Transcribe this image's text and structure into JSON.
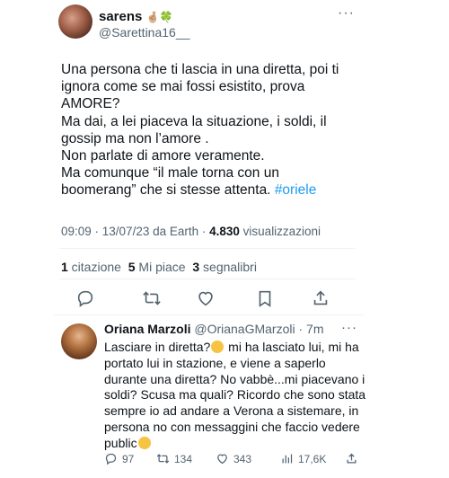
{
  "tweet": {
    "display_name": "sarens",
    "name_emojis": "🤞🏼🍀",
    "handle": "@Sarettina16__",
    "more_label": "···",
    "text_lines": [
      "Una persona che ti lascia in una diretta, poi ti",
      "ignora come se mai fossi esistito, prova",
      "AMORE?",
      "Ma dai, a lei piaceva la situazione, i soldi, il",
      "gossip ma non l’amore .",
      "Non parlate di amore veramente.",
      "Ma comunque “il male torna con un",
      "boomerang” che si stesse attenta. "
    ],
    "hashtag": "#oriele",
    "meta_time": "09:09 · 13/07/23 da Earth · ",
    "meta_views_count": "4.830",
    "meta_views_label": " visualizzazioni",
    "stats": {
      "quotes_count": "1",
      "quotes_label": " citazione",
      "likes_count": "5",
      "likes_label": " Mi piace",
      "bookmarks_count": "3",
      "bookmarks_label": " segnalibri"
    },
    "actions": [
      "reply-icon",
      "retweet-icon",
      "like-icon",
      "bookmark-icon",
      "share-icon"
    ]
  },
  "reply": {
    "display_name": "Oriana Marzoli",
    "handle_time": " @OrianaGMarzoli · 7m",
    "more_label": "···",
    "text_lines": [
      [
        "Lasciare in diretta?",
        "emoji",
        " mi ha lasciato lui, mi ha"
      ],
      [
        "portato lui in stazione, e viene a saperlo"
      ],
      [
        "durante una diretta? No vabbè...mi piacevano i"
      ],
      [
        "soldi? Scusa ma quali? Ricordo che sono stata"
      ],
      [
        "sempre io ad andare a Verona a sistemare, in"
      ],
      [
        "persona no con messaggini che faccio vedere"
      ],
      [
        "public",
        "emoji"
      ]
    ],
    "reply_count": "97",
    "retweet_count": "134",
    "like_count": "343",
    "views_count": "17,6K"
  },
  "colors": {
    "text": "#0f1419",
    "secondary": "#536471",
    "link": "#1d9bf0",
    "divider": "#eff3f4"
  }
}
